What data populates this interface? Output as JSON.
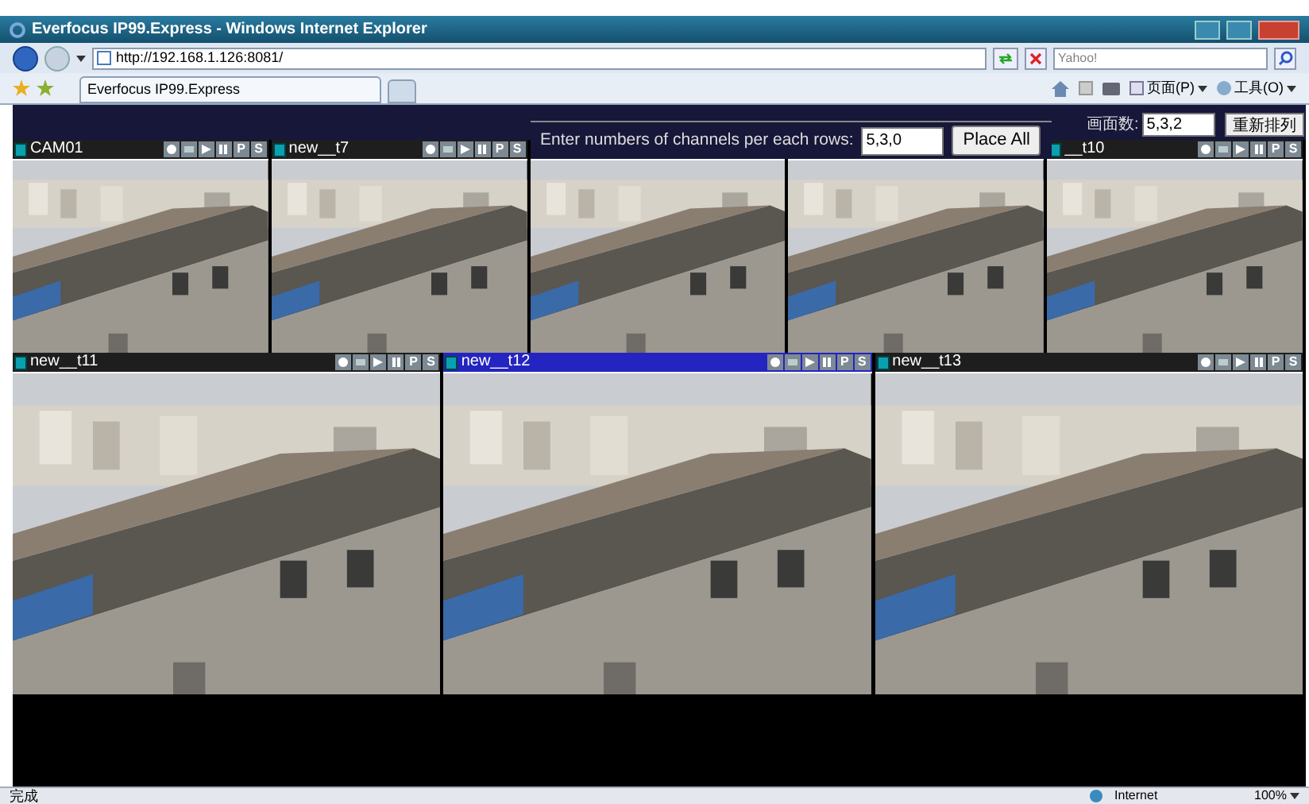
{
  "window": {
    "title": "Everfocus IP99.Express - Windows Internet Explorer"
  },
  "address_bar": {
    "url": "http://192.168.1.126:8081/"
  },
  "search": {
    "placeholder": "Yahoo!"
  },
  "tabs": [
    {
      "label": "Everfocus IP99.Express",
      "selected": true
    }
  ],
  "command_bar": [
    {
      "label": "页面(P)",
      "kind": "page"
    },
    {
      "label": "工具(O)",
      "kind": "tools"
    }
  ],
  "layout_panel": {
    "prompt": "Enter numbers of channels per each rows:",
    "value": "5,3,0",
    "button": "Place All"
  },
  "layout_panel_cn": {
    "prompt": "画面数:",
    "value": "5,3,2",
    "button": "重新排列"
  },
  "rows": [
    {
      "cameras": [
        {
          "kind": "camera",
          "title": "CAM01",
          "selected": false,
          "letters": [
            "P",
            "S"
          ]
        },
        {
          "kind": "camera",
          "title": "new__t7",
          "selected": false,
          "letters": [
            "P",
            "S"
          ]
        },
        {
          "kind": "covered"
        },
        {
          "kind": "covered"
        },
        {
          "kind": "camera",
          "title": "__t10",
          "selected": false,
          "letters": [
            "P",
            "S"
          ]
        }
      ]
    },
    {
      "cameras": [
        {
          "kind": "camera",
          "title": "new__t11",
          "selected": false,
          "letters": [
            "P",
            "S"
          ]
        },
        {
          "kind": "camera",
          "title": "new__t12",
          "selected": true,
          "letters": [
            "P",
            "S"
          ]
        },
        {
          "kind": "camera",
          "title": "new__t13",
          "selected": false,
          "letters": [
            "P",
            "S"
          ]
        }
      ]
    }
  ],
  "status_bar": {
    "text": "完成",
    "zone": "Internet",
    "zoom": "100%"
  }
}
